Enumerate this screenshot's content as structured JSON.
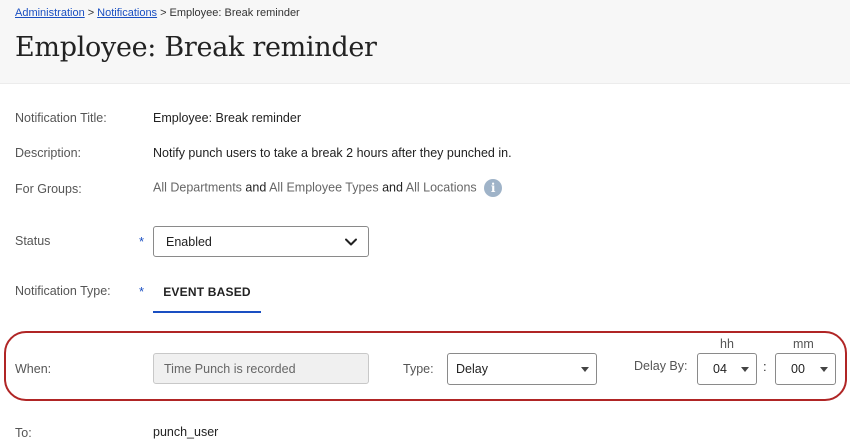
{
  "breadcrumb": {
    "items": [
      "Administration",
      "Notifications"
    ],
    "separator": ">",
    "current": "Employee: Break reminder"
  },
  "page": {
    "title": "Employee: Break reminder"
  },
  "details": {
    "notification_title_label": "Notification Title:",
    "notification_title_value": "Employee: Break reminder",
    "description_label": "Description:",
    "description_value": "Notify punch users to take a break 2 hours after they punched in.",
    "groups_label": "For Groups:",
    "groups": {
      "departments": "All Departments",
      "and1": "and",
      "employee_types": "All Employee Types",
      "and2": "and",
      "locations": "All Locations"
    },
    "info_icon_glyph": "i"
  },
  "status": {
    "label": "Status",
    "required_mark": "*",
    "value": "Enabled"
  },
  "notification_type": {
    "label": "Notification Type:",
    "required_mark": "*",
    "tab_label": "EVENT BASED"
  },
  "when": {
    "label": "When:",
    "trigger_value": "Time Punch is recorded",
    "type_label": "Type:",
    "type_value": "Delay",
    "delay_label": "Delay By:",
    "hh_label": "hh",
    "mm_label": "mm",
    "hours_value": "04",
    "minutes_value": "00",
    "time_separator": ":"
  },
  "to": {
    "label": "To:",
    "value": "punch_user"
  },
  "colors": {
    "link": "#1a4fc2",
    "accent_underline": "#1a4fc2",
    "highlight_ring": "#b02525",
    "info_icon": "#9fb3c8",
    "header_bg": "#f7f7f7"
  },
  "icons": {
    "status_dropdown": "chevron-down-icon",
    "type_dropdown": "caret-down-icon",
    "info": "info-icon"
  }
}
